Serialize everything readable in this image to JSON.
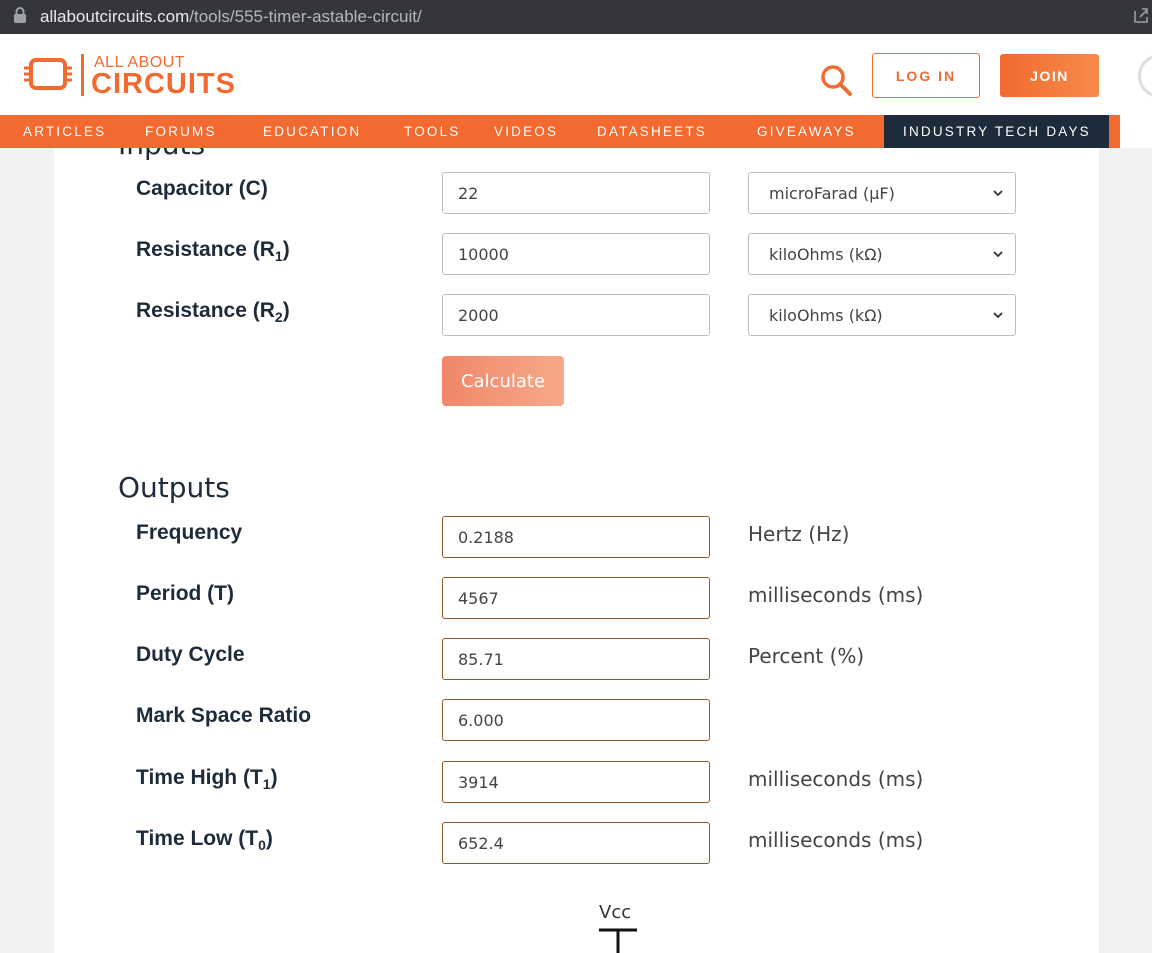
{
  "browser": {
    "url_domain": "allaboutcircuits.com",
    "url_path": "/tools/555-timer-astable-circuit/"
  },
  "header": {
    "logo_line1": "ALL ABOUT",
    "logo_line2": "CIRCUITS",
    "login_label": "LOG IN",
    "join_label": "JOIN"
  },
  "nav": {
    "items": [
      "ARTICLES",
      "FORUMS",
      "EDUCATION",
      "TOOLS",
      "VIDEOS",
      "DATASHEETS",
      "GIVEAWAYS",
      "INDUSTRY TECH DAYS"
    ]
  },
  "inputs": {
    "title": "Inputs",
    "rows": [
      {
        "label": "Capacitor (C)",
        "value": "22",
        "unit": "microFarad (µF)"
      },
      {
        "label": "Resistance (R",
        "sub": "1",
        "label_end": ")",
        "value": "10000",
        "unit": "kiloOhms (kΩ)"
      },
      {
        "label": "Resistance (R",
        "sub": "2",
        "label_end": ")",
        "value": "2000",
        "unit": "kiloOhms (kΩ)"
      }
    ],
    "calculate_label": "Calculate"
  },
  "outputs": {
    "title": "Outputs",
    "rows": [
      {
        "label": "Frequency",
        "value": "0.2188",
        "unit": "Hertz (Hz)"
      },
      {
        "label": "Period (T)",
        "value": "4567",
        "unit": "milliseconds (ms)"
      },
      {
        "label": "Duty Cycle",
        "value": "85.71",
        "unit": "Percent (%)"
      },
      {
        "label": "Mark Space Ratio",
        "value": "6.000",
        "unit": ""
      },
      {
        "label": "Time High (T",
        "sub": "1",
        "label_end": ")",
        "value": "3914",
        "unit": "milliseconds (ms)"
      },
      {
        "label": "Time Low (T",
        "sub": "0",
        "label_end": ")",
        "value": "652.4",
        "unit": "milliseconds (ms)"
      }
    ]
  },
  "schematic": {
    "vcc_label": "Vcc"
  },
  "colors": {
    "brand_orange": "#f26a2f",
    "navy": "#1d2b3a"
  }
}
